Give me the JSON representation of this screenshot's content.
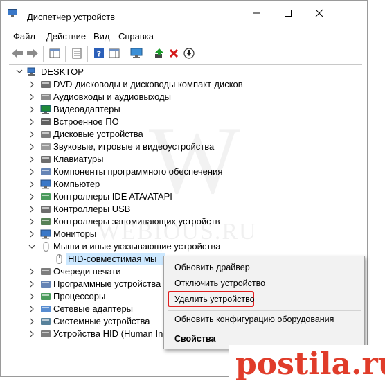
{
  "window": {
    "title": "Диспетчер устройств"
  },
  "menu": [
    "Файл",
    "Действие",
    "Вид",
    "Справка"
  ],
  "tree": {
    "root": "DESKTOP",
    "items": [
      {
        "label": "DVD-дисководы и дисководы компакт-дисков",
        "icon": "dvd-drive-icon",
        "expanded": false
      },
      {
        "label": "Аудиовходы и аудиовыходы",
        "icon": "audio-icon",
        "expanded": false
      },
      {
        "label": "Видеоадаптеры",
        "icon": "display-adapter-icon",
        "expanded": false
      },
      {
        "label": "Встроенное ПО",
        "icon": "firmware-icon",
        "expanded": false
      },
      {
        "label": "Дисковые устройства",
        "icon": "disk-drive-icon",
        "expanded": false
      },
      {
        "label": "Звуковые, игровые и видеоустройства",
        "icon": "speaker-icon",
        "expanded": false
      },
      {
        "label": "Клавиатуры",
        "icon": "keyboard-icon",
        "expanded": false
      },
      {
        "label": "Компоненты программного обеспечения",
        "icon": "software-components-icon",
        "expanded": false
      },
      {
        "label": "Компьютер",
        "icon": "computer-icon",
        "expanded": false
      },
      {
        "label": "Контроллеры IDE ATA/ATAPI",
        "icon": "ide-controller-icon",
        "expanded": false
      },
      {
        "label": "Контроллеры USB",
        "icon": "usb-icon",
        "expanded": false
      },
      {
        "label": "Контроллеры запоминающих устройств",
        "icon": "storage-controller-icon",
        "expanded": false
      },
      {
        "label": "Мониторы",
        "icon": "monitor-icon",
        "expanded": false
      },
      {
        "label": "Мыши и иные указывающие устройства",
        "icon": "mouse-icon",
        "expanded": true
      },
      {
        "label": "HID-совместимая мы",
        "icon": "mouse-icon",
        "child": true,
        "selected": true
      },
      {
        "label": "Очереди печати",
        "icon": "printer-icon",
        "expanded": false
      },
      {
        "label": "Программные устройства",
        "icon": "software-device-icon",
        "expanded": false
      },
      {
        "label": "Процессоры",
        "icon": "processor-icon",
        "expanded": false
      },
      {
        "label": "Сетевые адаптеры",
        "icon": "network-adapter-icon",
        "expanded": false
      },
      {
        "label": "Системные устройства",
        "icon": "system-devices-icon",
        "expanded": false
      },
      {
        "label": "Устройства HID (Human In",
        "icon": "hid-icon",
        "expanded": false
      }
    ]
  },
  "context_menu": {
    "items": [
      "Обновить драйвер",
      "Отключить устройство",
      "Удалить устройство",
      "Обновить конфигурацию оборудования",
      "Свойства"
    ],
    "highlighted": "Удалить устройство",
    "highlight_color": "#e12020"
  },
  "watermark": "WEBIOUS.RU",
  "watermark_letter": "W",
  "brand": "postila.ru",
  "brand_color": "#e03c2a"
}
